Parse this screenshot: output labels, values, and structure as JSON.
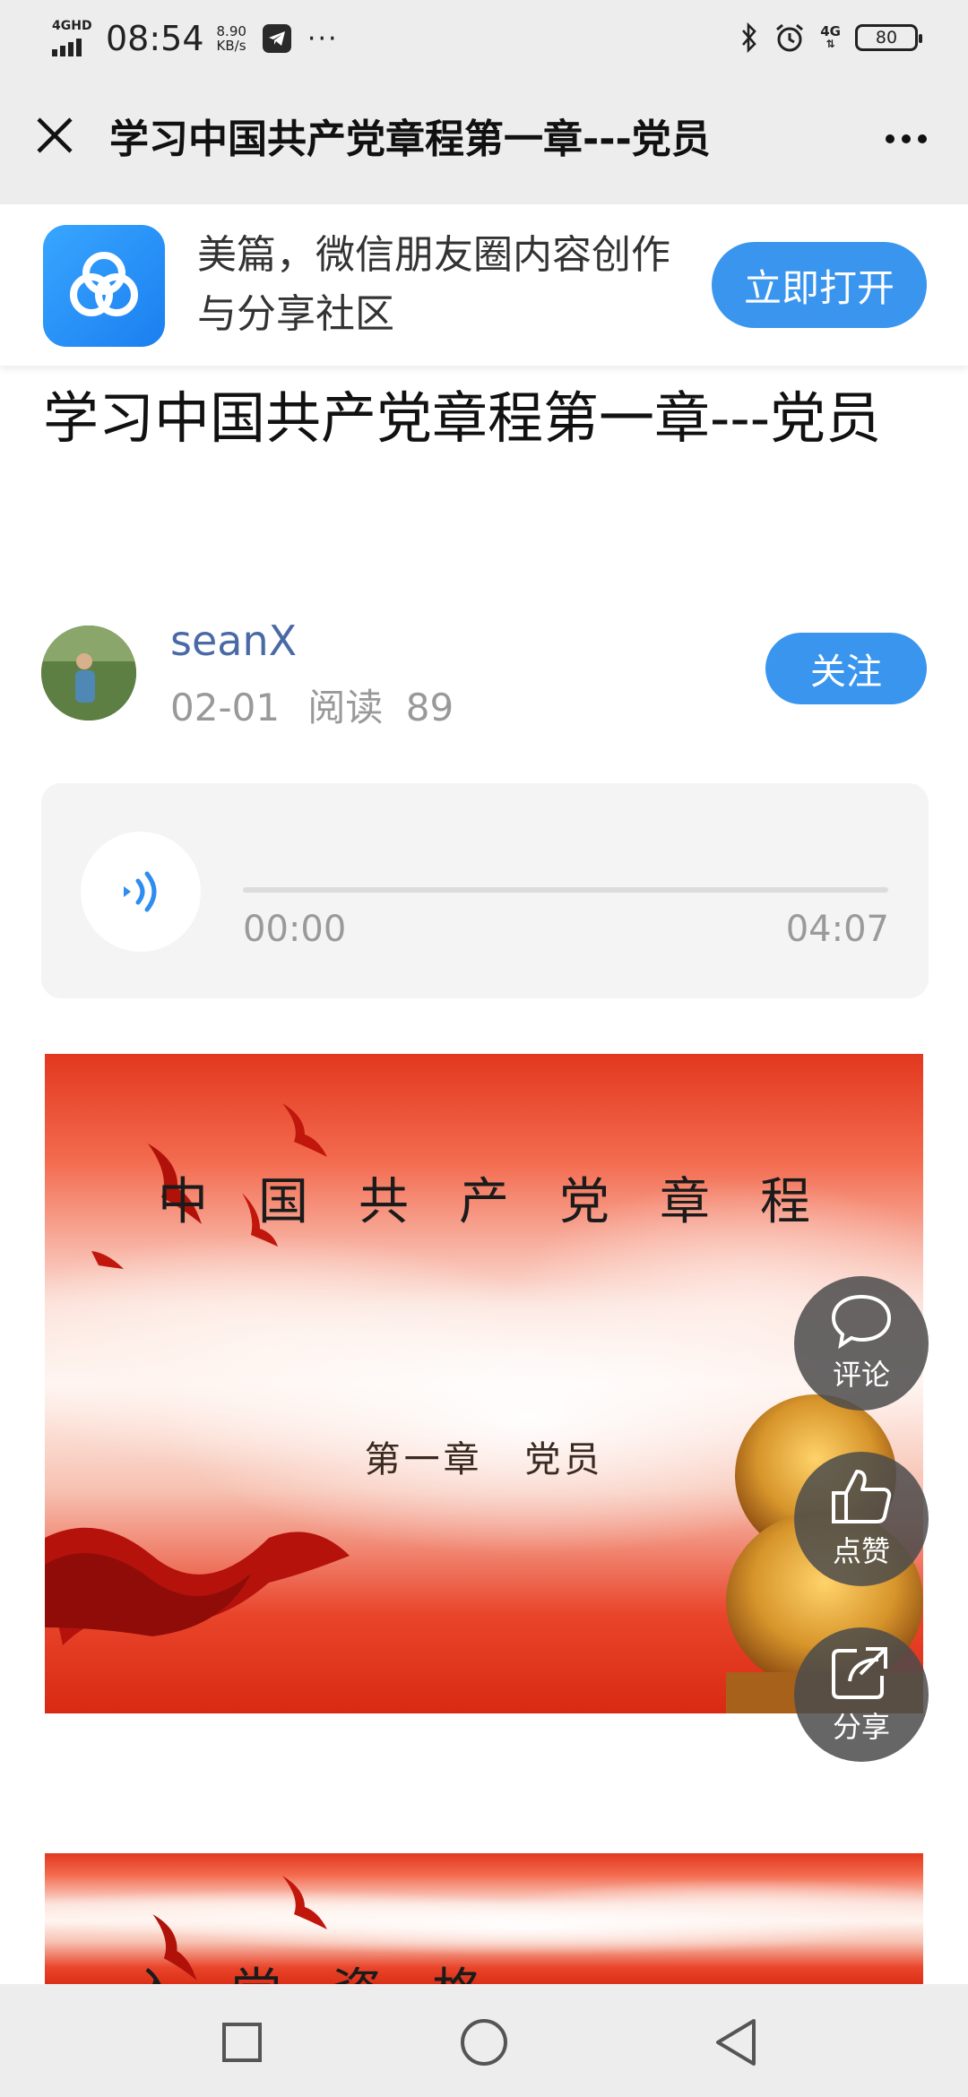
{
  "status_bar": {
    "network_label": "4GHD",
    "time": "08:54",
    "speed_value": "8.90",
    "speed_unit": "KB/s",
    "overflow": "···",
    "net_right": "4G",
    "battery": "80"
  },
  "title_bar": {
    "title": "学习中国共产党章程第一章---党员"
  },
  "app_banner": {
    "description": "美篇，微信朋友圈内容创作与分享社区",
    "open_label": "立即打开",
    "brand_color": "#3a95ee"
  },
  "article": {
    "title": "学习中国共产党章程第一章---党员",
    "author": "seanX",
    "date": "02-01",
    "reads_label": "阅读",
    "reads_count": "89",
    "follow_label": "关注"
  },
  "audio": {
    "current_time": "00:00",
    "total_time": "04:07",
    "progress": 0
  },
  "slides": [
    {
      "title": "中国共产党章程",
      "subtitle": "第一章 党员"
    },
    {
      "title": "入党资格"
    }
  ],
  "actions": {
    "comment_label": "评论",
    "like_label": "点赞",
    "share_label": "分享"
  },
  "icons": {
    "close": "close-icon",
    "more": "more-icon",
    "app_logo": "meipian-logo-icon",
    "audio": "speaker-icon",
    "comment": "comment-icon",
    "like": "thumbs-up-icon",
    "share": "share-icon",
    "recent": "square-icon",
    "home": "circle-icon",
    "back": "triangle-back-icon"
  }
}
